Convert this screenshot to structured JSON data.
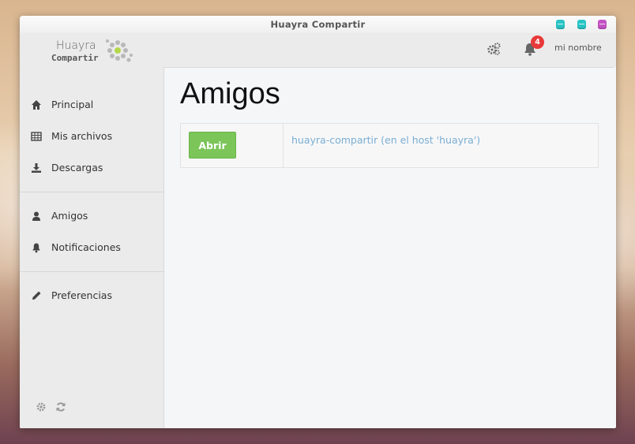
{
  "window": {
    "title": "Huayra Compartir",
    "buttons": [
      {
        "name": "minimize",
        "color": "#2ac4c4"
      },
      {
        "name": "maximize",
        "color": "#2ac4c4"
      },
      {
        "name": "close",
        "color": "#c451c4"
      }
    ]
  },
  "header": {
    "logo_line1": "Huayra",
    "logo_line2": "Compartir",
    "notification_count": "4",
    "user_name": "mi nombre"
  },
  "sidebar": {
    "items": [
      {
        "label": "Principal",
        "icon": "home-icon"
      },
      {
        "label": "Mis archivos",
        "icon": "table-icon"
      },
      {
        "label": "Descargas",
        "icon": "download-icon"
      },
      {
        "label": "Amigos",
        "icon": "user-icon"
      },
      {
        "label": "Notificaciones",
        "icon": "bell-icon"
      },
      {
        "label": "Preferencias",
        "icon": "pencil-icon"
      }
    ],
    "footer_icons": [
      "gear-icon",
      "refresh-icon"
    ]
  },
  "main": {
    "title": "Amigos",
    "friends": [
      {
        "button_label": "Abrir",
        "name": "huayra-compartir (en el host 'huayra')"
      }
    ]
  },
  "colors": {
    "accent_green": "#7cc559",
    "link_blue": "#7aaed2",
    "badge_red": "#e8393a"
  }
}
